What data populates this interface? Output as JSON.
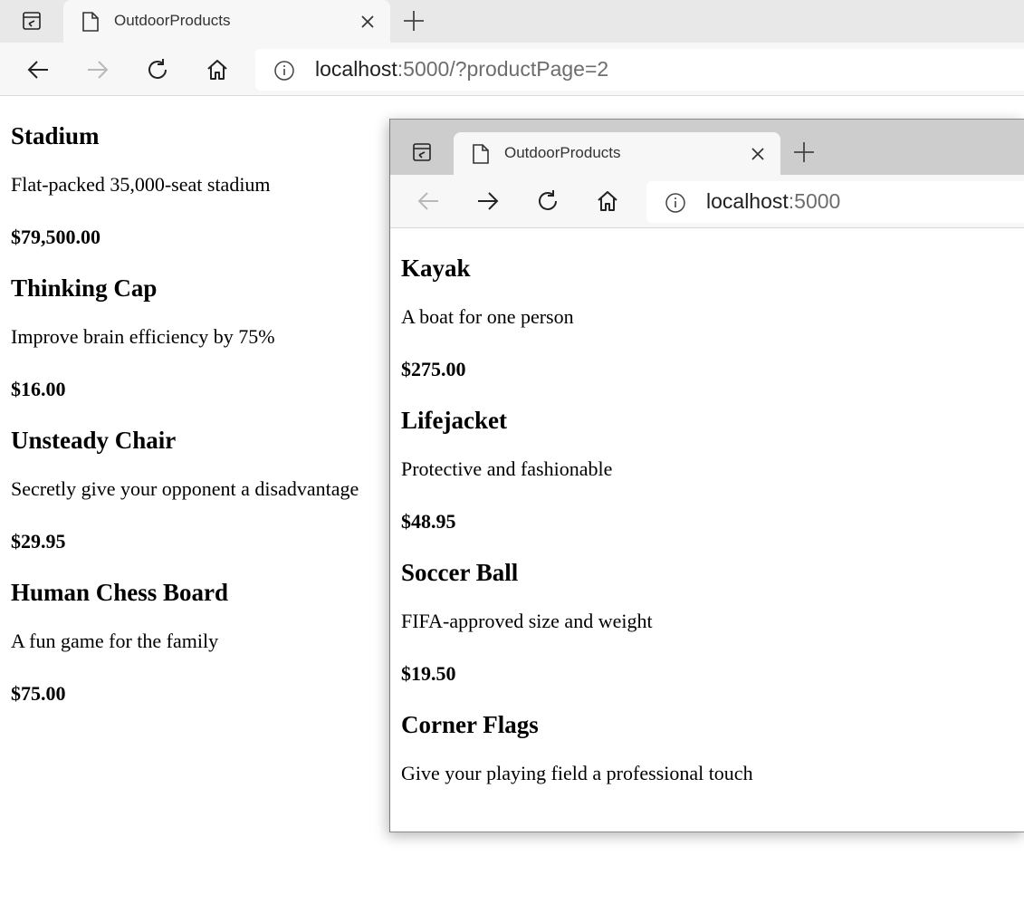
{
  "main_window": {
    "tab_title": "OutdoorProducts",
    "url_host": "localhost",
    "url_rest": ":5000/?productPage=2",
    "products": [
      {
        "name": "Stadium",
        "description": "Flat-packed 35,000-seat stadium",
        "price": "$79,500.00"
      },
      {
        "name": "Thinking Cap",
        "description": "Improve brain efficiency by 75%",
        "price": "$16.00"
      },
      {
        "name": "Unsteady Chair",
        "description": "Secretly give your opponent a disadvantage",
        "price": "$29.95"
      },
      {
        "name": "Human Chess Board",
        "description": "A fun game for the family",
        "price": "$75.00"
      }
    ]
  },
  "popup_window": {
    "tab_title": "OutdoorProducts",
    "url_host": "localhost",
    "url_rest": ":5000",
    "products": [
      {
        "name": "Kayak",
        "description": "A boat for one person",
        "price": "$275.00"
      },
      {
        "name": "Lifejacket",
        "description": "Protective and fashionable",
        "price": "$48.95"
      },
      {
        "name": "Soccer Ball",
        "description": "FIFA-approved size and weight",
        "price": "$19.50"
      },
      {
        "name": "Corner Flags",
        "description": "Give your playing field a professional touch",
        "price": ""
      }
    ]
  },
  "icons": {
    "tab_actions": "tab-actions-icon",
    "page": "page-icon",
    "close": "close-icon",
    "new_tab": "plus-icon",
    "back": "back-arrow-icon",
    "forward": "forward-arrow-icon",
    "refresh": "refresh-icon",
    "home": "home-icon",
    "info": "info-icon"
  }
}
